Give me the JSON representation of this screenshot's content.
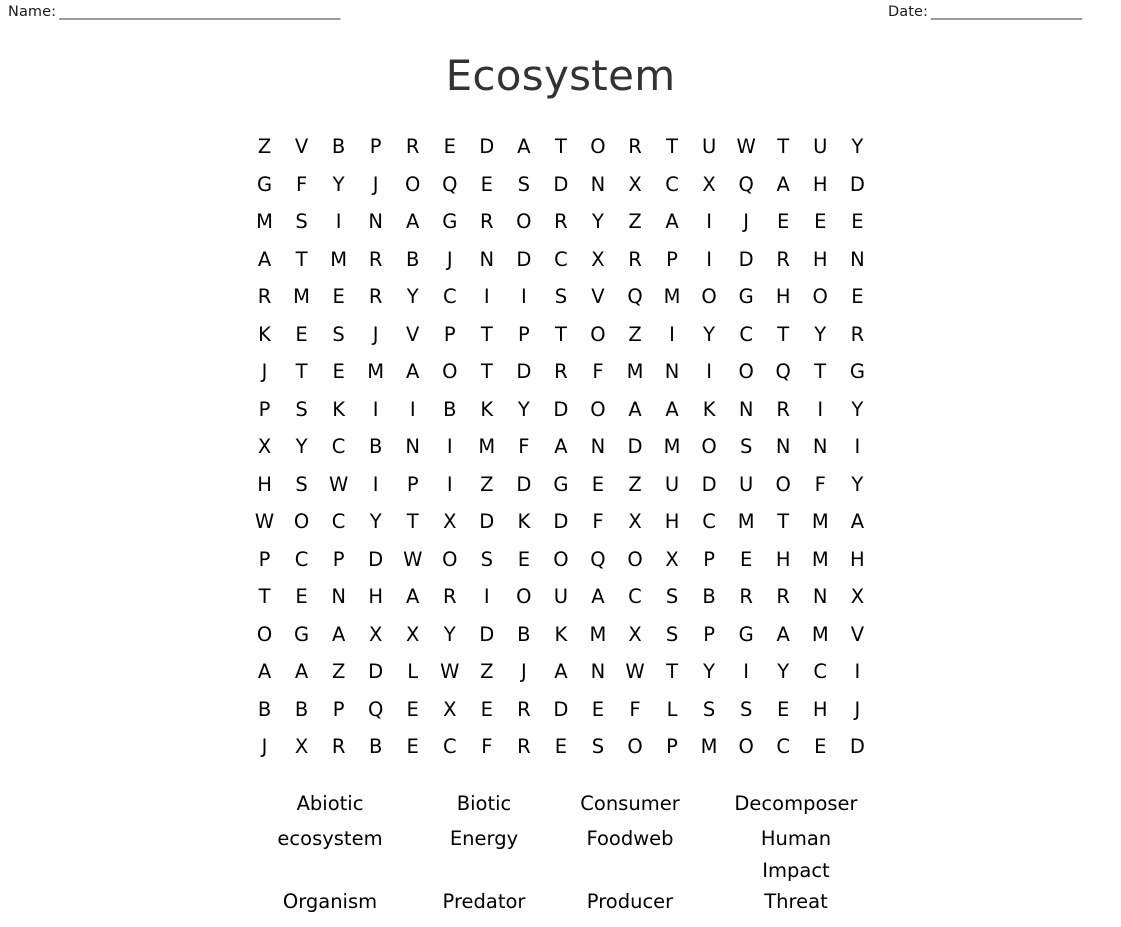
{
  "header": {
    "name_label": "Name:",
    "name_rule": "_________________________________________",
    "date_label": "Date:",
    "date_rule": "______________________"
  },
  "title": "Ecosystem",
  "colors": {
    "page_background": "#ffffff",
    "title_text": "#333333",
    "grid_text": "#000000",
    "header_text": "#1a1a1a",
    "rule_text": "#3a3a3a"
  },
  "puzzle": {
    "columns": 17,
    "rows": 17,
    "grid": [
      [
        "Z",
        "V",
        "B",
        "P",
        "R",
        "E",
        "D",
        "A",
        "T",
        "O",
        "R",
        "T",
        "U",
        "W",
        "T",
        "U",
        "Y"
      ],
      [
        "G",
        "F",
        "Y",
        "J",
        "O",
        "Q",
        "E",
        "S",
        "D",
        "N",
        "X",
        "C",
        "X",
        "Q",
        "A",
        "H",
        "D"
      ],
      [
        "M",
        "S",
        "I",
        "N",
        "A",
        "G",
        "R",
        "O",
        "R",
        "Y",
        "Z",
        "A",
        "I",
        "J",
        "E",
        "E",
        "E"
      ],
      [
        "A",
        "T",
        "M",
        "R",
        "B",
        "J",
        "N",
        "D",
        "C",
        "X",
        "R",
        "P",
        "I",
        "D",
        "R",
        "H",
        "N"
      ],
      [
        "R",
        "M",
        "E",
        "R",
        "Y",
        "C",
        "I",
        "I",
        "S",
        "V",
        "Q",
        "M",
        "O",
        "G",
        "H",
        "O",
        "E"
      ],
      [
        "K",
        "E",
        "S",
        "J",
        "V",
        "P",
        "T",
        "P",
        "T",
        "O",
        "Z",
        "I",
        "Y",
        "C",
        "T",
        "Y",
        "R"
      ],
      [
        "J",
        "T",
        "E",
        "M",
        "A",
        "O",
        "T",
        "D",
        "R",
        "F",
        "M",
        "N",
        "I",
        "O",
        "Q",
        "T",
        "G"
      ],
      [
        "P",
        "S",
        "K",
        "I",
        "I",
        "B",
        "K",
        "Y",
        "D",
        "O",
        "A",
        "A",
        "K",
        "N",
        "R",
        "I",
        "Y"
      ],
      [
        "X",
        "Y",
        "C",
        "B",
        "N",
        "I",
        "M",
        "F",
        "A",
        "N",
        "D",
        "M",
        "O",
        "S",
        "N",
        "N",
        "I"
      ],
      [
        "H",
        "S",
        "W",
        "I",
        "P",
        "I",
        "Z",
        "D",
        "G",
        "E",
        "Z",
        "U",
        "D",
        "U",
        "O",
        "F",
        "Y"
      ],
      [
        "W",
        "O",
        "C",
        "Y",
        "T",
        "X",
        "D",
        "K",
        "D",
        "F",
        "X",
        "H",
        "C",
        "M",
        "T",
        "M",
        "A"
      ],
      [
        "P",
        "C",
        "P",
        "D",
        "W",
        "O",
        "S",
        "E",
        "O",
        "Q",
        "O",
        "X",
        "P",
        "E",
        "H",
        "M",
        "H"
      ],
      [
        "T",
        "E",
        "N",
        "H",
        "A",
        "R",
        "I",
        "O",
        "U",
        "A",
        "C",
        "S",
        "B",
        "R",
        "R",
        "N",
        "X"
      ],
      [
        "O",
        "G",
        "A",
        "X",
        "X",
        "Y",
        "D",
        "B",
        "K",
        "M",
        "X",
        "S",
        "P",
        "G",
        "A",
        "M",
        "V"
      ],
      [
        "A",
        "A",
        "Z",
        "D",
        "L",
        "W",
        "Z",
        "J",
        "A",
        "N",
        "W",
        "T",
        "Y",
        "I",
        "Y",
        "C",
        "I"
      ],
      [
        "B",
        "B",
        "P",
        "Q",
        "E",
        "X",
        "E",
        "R",
        "D",
        "E",
        "F",
        "L",
        "S",
        "S",
        "E",
        "H",
        "J"
      ],
      [
        "J",
        "X",
        "R",
        "B",
        "E",
        "C",
        "F",
        "R",
        "E",
        "S",
        "O",
        "P",
        "M",
        "O",
        "C",
        "E",
        "D"
      ]
    ]
  },
  "wordlist": {
    "rows": [
      [
        {
          "lines": [
            "Abiotic"
          ]
        },
        {
          "lines": [
            "Biotic"
          ]
        },
        {
          "lines": [
            "Consumer"
          ]
        },
        {
          "lines": [
            "Decomposer"
          ]
        }
      ],
      [
        {
          "lines": [
            "ecosystem"
          ]
        },
        {
          "lines": [
            "Energy"
          ]
        },
        {
          "lines": [
            "Foodweb"
          ]
        },
        {
          "lines": [
            "Human",
            "Impact"
          ]
        }
      ],
      [
        {
          "lines": [
            "Organism"
          ]
        },
        {
          "lines": [
            "Predator"
          ]
        },
        {
          "lines": [
            "Producer"
          ]
        },
        {
          "lines": [
            "Threat"
          ]
        }
      ]
    ],
    "all_words": [
      "Abiotic",
      "Biotic",
      "Consumer",
      "Decomposer",
      "ecosystem",
      "Energy",
      "Foodweb",
      "Human Impact",
      "Organism",
      "Predator",
      "Producer",
      "Threat"
    ]
  }
}
